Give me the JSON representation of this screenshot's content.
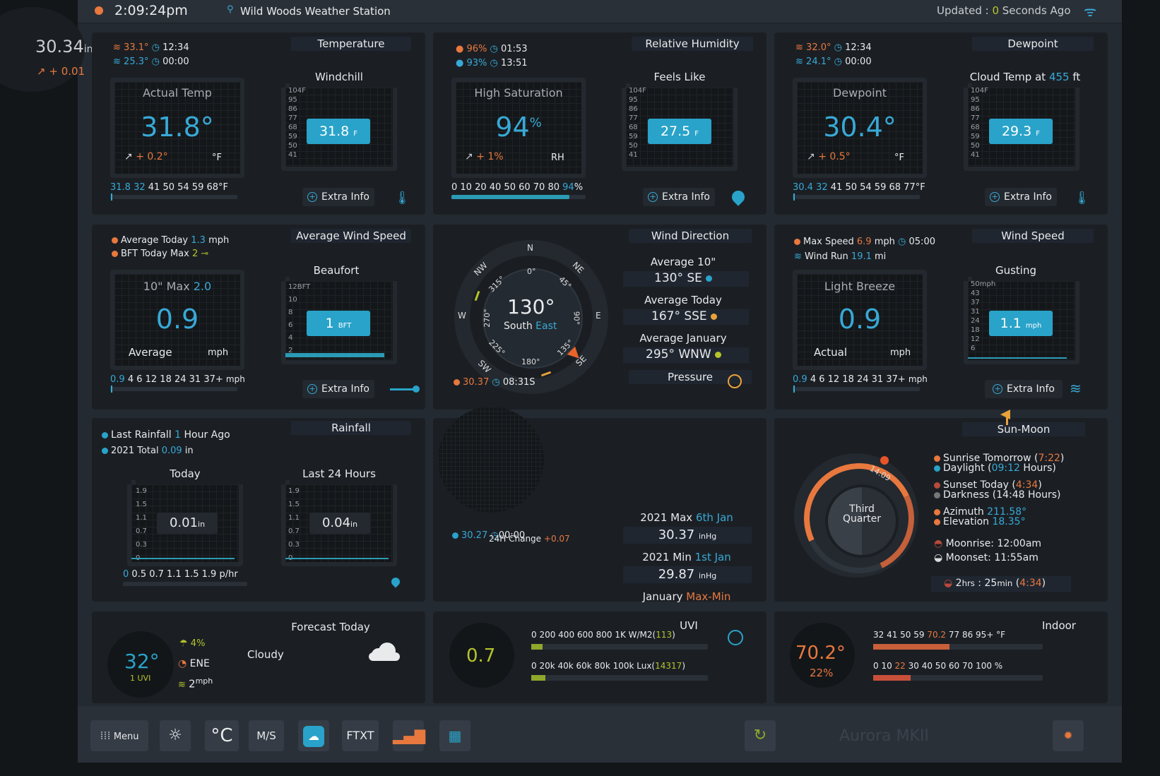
{
  "header": {
    "time": "2:09:24pm",
    "station": "Wild Woods Weather Station",
    "updated_prefix": "Updated : ",
    "updated_value": "0",
    "updated_suffix": " Seconds Ago"
  },
  "pressure_corner": {
    "value": "30.34",
    "unit": "inHg",
    "trend": "+ 0.01"
  },
  "temperature": {
    "title": "Temperature",
    "max": "33.1°",
    "max_time": "12:34",
    "min": "25.3°",
    "min_time": "00:00",
    "card_label": "Actual Temp",
    "value": "31.8°",
    "trend": "+ 0.2°",
    "unit": "°F",
    "gauge_title": "Windchill",
    "gauge_value": "31.8",
    "gauge_unit": "F",
    "scale": [
      "104F",
      "95",
      "86",
      "77",
      "68",
      "59",
      "50",
      "41"
    ],
    "range_a": "31.8",
    "range_b": "32",
    "range_rest": "41 50 54 59 68°F",
    "extra": "Extra Info"
  },
  "humidity": {
    "title": "Relative Humidity",
    "max": "96%",
    "max_time": "01:53",
    "min": "93%",
    "min_time": "13:51",
    "card_label": "High Saturation",
    "value": "94",
    "unit_sup": "%",
    "trend": "+ 1%",
    "unit": "RH",
    "gauge_title": "Feels Like",
    "gauge_value": "27.5",
    "gauge_unit": "F",
    "scale": [
      "104F",
      "95",
      "86",
      "77",
      "68",
      "59",
      "50",
      "41"
    ],
    "range_text": "0 10 20 40 50 60 70 80",
    "range_value": "94",
    "range_pct": "%",
    "fill_fraction": 0.88,
    "extra": "Extra Info"
  },
  "dewpoint": {
    "title": "Dewpoint",
    "max": "32.0°",
    "max_time": "12:34",
    "min": "24.1°",
    "min_time": "00:00",
    "card_label": "Dewpoint",
    "value": "30.4°",
    "trend": "+ 0.5°",
    "unit": "°F",
    "gauge_title_prefix": "Cloud Temp at ",
    "gauge_title_value": "455",
    "gauge_title_suffix": " ft",
    "gauge_value": "29.3",
    "gauge_unit": "F",
    "scale": [
      "104F",
      "95",
      "86",
      "77",
      "68",
      "59",
      "50",
      "41"
    ],
    "range_a": "30.4",
    "range_b": "32",
    "range_rest": "41 50 54 59 68 77°F",
    "extra": "Extra Info"
  },
  "avg_wind": {
    "title": "Average Wind Speed",
    "line1_prefix": "Average Today ",
    "line1_value": "1.3",
    "line1_unit": " mph",
    "line2_prefix": "BFT Today Max ",
    "line2_value": "2",
    "card_label": "10\" Max ",
    "card_value": "2.0",
    "value": "0.9",
    "left_label": "Average",
    "right_label": "mph",
    "gauge_title": "Beaufort",
    "gauge_value": "1",
    "gauge_unit": "BFT",
    "scale": [
      "12BFT",
      "10",
      "8",
      "6",
      "4",
      "2"
    ],
    "range_a": "0.9",
    "range_rest": "4 6 12 18 24 31 37+",
    "range_unit": "mph",
    "extra": "Extra Info"
  },
  "wind_dir": {
    "title": "Wind Direction",
    "compass_value": "130°",
    "compass_dir1": "South ",
    "compass_dir2": "East",
    "labels": {
      "n": "N",
      "ne": "NE",
      "e": "E",
      "se": "SE",
      "s": "180°",
      "sw": "SW",
      "w": "W",
      "nw": "NW",
      "d0": "0°",
      "d45": "45°",
      "d90": "90°",
      "d135": "135°",
      "d225": "225°",
      "d270": "270°",
      "d315": "315°"
    },
    "avg10_label": "Average 10\"",
    "avg10_value": "130°  SE",
    "avgToday_label": "Average Today",
    "avgToday_value": "167°  SSE",
    "avgJan_label": "Average January",
    "avgJan_value": "295°  WNW",
    "pressure_label": "Pressure",
    "bottom_value": "30.37",
    "bottom_time": "08:31S"
  },
  "wind_speed": {
    "title": "Wind Speed",
    "line1_prefix": "Max Speed ",
    "line1_value": "6.9",
    "line1_unit": " mph",
    "line1_time": "05:00",
    "line2_prefix": "Wind Run  ",
    "line2_value": "19.1",
    "line2_unit": " mi",
    "card_label": "Light Breeze",
    "value": "0.9",
    "left_label": "Actual",
    "right_label": "mph",
    "gauge_title": "Gusting",
    "gauge_value": "1.1",
    "gauge_unit": "mph",
    "scale": [
      "50mph",
      "43",
      "37",
      "31",
      "24",
      "18",
      "12",
      "6"
    ],
    "range_a": "0.9",
    "range_rest": "4 6 12 18 24 31 37+",
    "range_unit": "mph",
    "extra": "Extra Info"
  },
  "rainfall": {
    "title": "Rainfall",
    "line1_prefix": "Last Rainfall ",
    "line1_value": "1",
    "line1_suffix": " Hour Ago",
    "line2_prefix": "2021 Total ",
    "line2_value": "0.09",
    "line2_unit": " in",
    "today_label": "Today",
    "today_value": "0.01",
    "today_unit": "in",
    "last24_label": "Last 24 Hours",
    "last24_value": "0.04",
    "last24_unit": "in",
    "scale": [
      "1.9",
      "1.5",
      "1.1",
      "0.7",
      "0.3",
      "0"
    ],
    "range_a": "0",
    "range_rest": "0.5 0.7 1.1 1.5 1.9 p/hr"
  },
  "pressure": {
    "bottom_value": "30.27",
    "bottom_time": "00:00",
    "change_label": "24H Change",
    "change_value": "+0.07",
    "max_prefix": "2021 Max ",
    "max_date": "6th Jan",
    "max_value": "30.37",
    "max_unit": "inHg",
    "min_prefix": "2021 Min ",
    "min_date": "1st Jan",
    "min_value": "29.87",
    "min_unit": "inHg",
    "jan_prefix": "January ",
    "jan_value": "Max-Min"
  },
  "sunmoon": {
    "title": "Sun-Moon",
    "phase": "Third Quarter",
    "arc_time": "14:09",
    "sunrise_prefix": "Sunrise Tomorrow (",
    "sunrise_value": "7:22",
    "daylight_prefix": "Daylight (",
    "daylight_value": "09:12",
    "daylight_suffix": " Hours)",
    "sunset_prefix": "Sunset Today (",
    "sunset_value": "4:34",
    "darkness": "Darkness (14:48 Hours)",
    "azimuth_prefix": "Azimuth ",
    "azimuth_value": "211.58°",
    "elevation_prefix": "Elevation ",
    "elevation_value": "18.35°",
    "moonrise": "Moonrise: 12:00am",
    "moonset": "Moonset: 11:55am",
    "remain_h": "2",
    "remain_m": "25",
    "remain_paren": "4:34"
  },
  "forecast": {
    "title": "Forecast Today",
    "temp": "32°",
    "uvi": "1 UVI",
    "rain": "4%",
    "wind_dir": "ENE",
    "wind_speed": "2",
    "wind_unit": "mph",
    "condition": "Cloudy"
  },
  "uvi": {
    "title": "UVI",
    "value": "0.7",
    "scale1": "0 200 400 600 800 1K W/M2(",
    "scale1_value": "113",
    "scale2": "0 20k 40k 60k 80k 100k Lux(",
    "scale2_value": "14317"
  },
  "indoor": {
    "title": "Indoor",
    "temp": "70.2°",
    "humidity": "22%",
    "scale1_pre": "32 41 50 59 ",
    "scale1_val": "70.2",
    "scale1_post": " 77 86 95+ °F",
    "scale2_pre": "0 10 ",
    "scale2_val": "22",
    "scale2_post": " 30 40 50 60 70 100 %",
    "temp_fraction": 0.45,
    "hum_fraction": 0.22
  },
  "footer": {
    "menu": "Menu",
    "celsius": "°C",
    "ms": "M/S",
    "ftxt": "FTXT",
    "brand": "Aurora MKII"
  },
  "colors": {
    "accent": "#38a9d6",
    "orange": "#e8783e",
    "yellow": "#b5c42c",
    "panel": "#1b1f24"
  }
}
